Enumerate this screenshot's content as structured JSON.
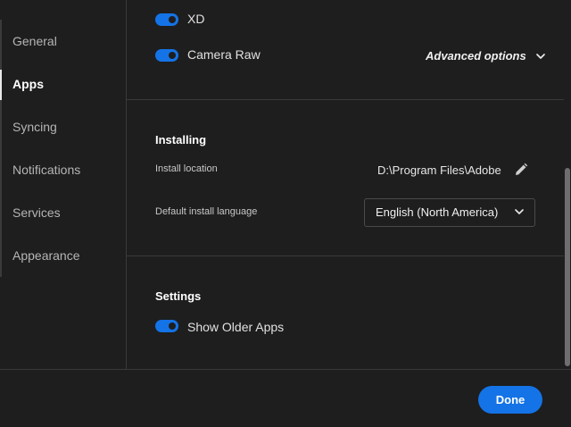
{
  "sidebar": {
    "items": [
      {
        "label": "General",
        "active": false
      },
      {
        "label": "Apps",
        "active": true
      },
      {
        "label": "Syncing",
        "active": false
      },
      {
        "label": "Notifications",
        "active": false
      },
      {
        "label": "Services",
        "active": false
      },
      {
        "label": "Appearance",
        "active": false
      }
    ]
  },
  "apps": {
    "toggles": [
      {
        "label": "XD",
        "on": true
      },
      {
        "label": "Camera Raw",
        "on": true
      }
    ],
    "advanced_options_label": "Advanced options"
  },
  "installing": {
    "title": "Installing",
    "install_location_label": "Install location",
    "install_location_value": "D:\\Program Files\\Adobe",
    "language_label": "Default install language",
    "language_value": "English (North America)"
  },
  "settings": {
    "title": "Settings",
    "show_older_apps_label": "Show Older Apps",
    "show_older_apps_on": true
  },
  "footer": {
    "done_label": "Done"
  },
  "colors": {
    "accent": "#1473e6",
    "background": "#1e1e1e",
    "divider": "#3a3a3a"
  },
  "icons": [
    "chevron-down-icon",
    "pencil-icon"
  ]
}
